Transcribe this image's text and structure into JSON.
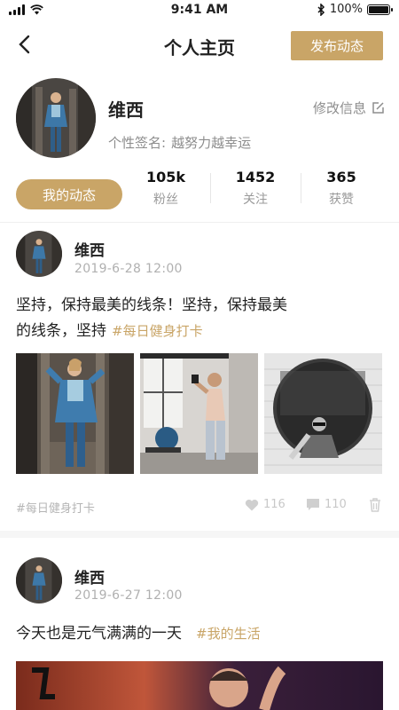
{
  "status_bar": {
    "time": "9:41 AM",
    "battery": "100%",
    "battery_level": 1.0
  },
  "nav": {
    "title": "个人主页",
    "publish_label": "发布动态"
  },
  "profile": {
    "name": "维西",
    "edit_label": "修改信息",
    "signature_label": "个性签名:",
    "signature": "越努力越幸运",
    "my_posts_label": "我的动态",
    "stats": [
      {
        "value": "105k",
        "label": "粉丝"
      },
      {
        "value": "1452",
        "label": "关注"
      },
      {
        "value": "365",
        "label": "获赞"
      }
    ]
  },
  "posts": [
    {
      "author": "维西",
      "date": "2019-6-28 12:00",
      "text_line1": "坚持，保持最美的线条！坚持，保持最美",
      "text_line2": "的线条，坚持",
      "tag": "#每日健身打卡",
      "footer_tag": "#每日健身打卡",
      "likes": "116",
      "comments": "110"
    },
    {
      "author": "维西",
      "date": "2019-6-27 12:00",
      "text": "今天也是元气满满的一天",
      "tag": "#我的生活"
    }
  ],
  "colors": {
    "accent": "#c9a567",
    "muted": "#8d8d8d"
  }
}
